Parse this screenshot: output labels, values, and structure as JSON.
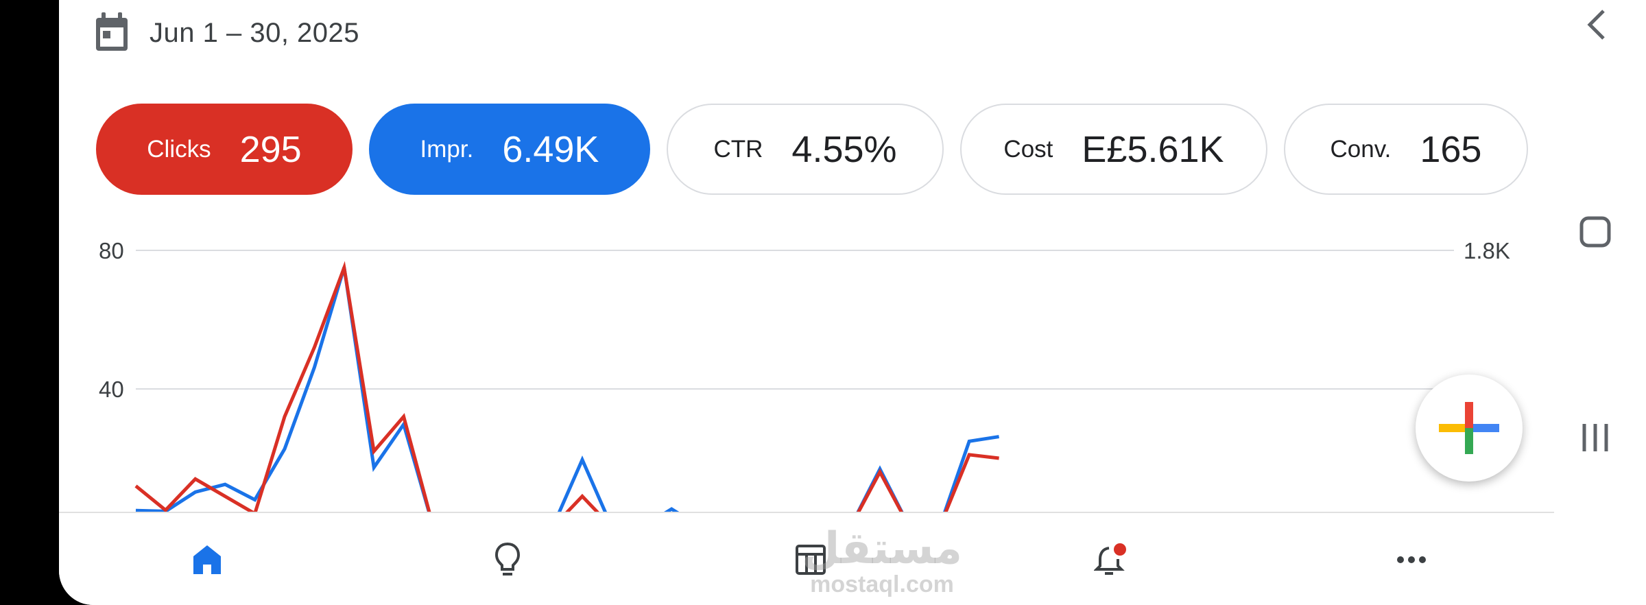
{
  "header": {
    "date_range": "Jun 1 – 30, 2025",
    "calendar_icon": "calendar-icon"
  },
  "metrics": [
    {
      "label": "Clicks",
      "value": "295",
      "color": "#d93025",
      "selected": true
    },
    {
      "label": "Impr.",
      "value": "6.49K",
      "color": "#1a73e8",
      "selected": true
    },
    {
      "label": "CTR",
      "value": "4.55%",
      "selected": false
    },
    {
      "label": "Cost",
      "value": "E£5.61K",
      "selected": false
    },
    {
      "label": "Conv.",
      "value": "165",
      "selected": false
    }
  ],
  "chart_data": {
    "type": "line",
    "left_axis_ticks": [
      "80",
      "40"
    ],
    "right_axis_ticks": [
      "1.8K"
    ],
    "ylim_left": [
      0,
      80
    ],
    "series": [
      {
        "name": "Clicks",
        "color": "#d93025",
        "axis": "left",
        "x": [
          1,
          2,
          3,
          4,
          5,
          6,
          7,
          8,
          9,
          10,
          11,
          12,
          13,
          14,
          15,
          16,
          17,
          18,
          19,
          20,
          21,
          22,
          23,
          24,
          25,
          26,
          27,
          28,
          29,
          30
        ],
        "values": [
          12,
          5,
          14,
          9,
          4,
          32,
          52,
          75,
          22,
          32,
          0,
          0,
          0,
          0,
          0,
          9,
          0,
          0,
          0,
          0,
          0,
          0,
          0,
          0,
          0,
          16,
          0,
          0,
          21,
          20
        ]
      },
      {
        "name": "Impr.",
        "color": "#1a73e8",
        "axis": "right",
        "x": [
          1,
          2,
          3,
          4,
          5,
          6,
          7,
          8,
          9,
          10,
          11,
          12,
          13,
          14,
          15,
          16,
          17,
          18,
          19,
          20,
          21,
          22,
          23,
          24,
          25,
          26,
          27,
          28,
          29,
          30
        ],
        "values": [
          110,
          105,
          230,
          280,
          180,
          510,
          1040,
          1690,
          390,
          670,
          0,
          0,
          0,
          0,
          0,
          440,
          0,
          0,
          120,
          0,
          0,
          0,
          0,
          0,
          0,
          380,
          0,
          0,
          560,
          590
        ]
      }
    ],
    "grid": true
  },
  "fab": {
    "icon": "plus-icon",
    "colors": [
      "#ea4335",
      "#4285f4",
      "#34a853",
      "#fbbc04"
    ]
  },
  "bottom_nav": [
    {
      "icon": "home-icon",
      "active": true,
      "color": "#1a73e8"
    },
    {
      "icon": "lightbulb-icon",
      "active": false
    },
    {
      "icon": "table-icon",
      "active": false
    },
    {
      "icon": "notifications-icon",
      "active": false,
      "badge_color": "#d93025"
    },
    {
      "icon": "more-icon",
      "active": false
    }
  ],
  "watermark": {
    "arabic": "مستقل",
    "latin": "mostaql.com"
  },
  "system_nav": [
    "back-icon",
    "home-square-icon",
    "recents-icon"
  ]
}
